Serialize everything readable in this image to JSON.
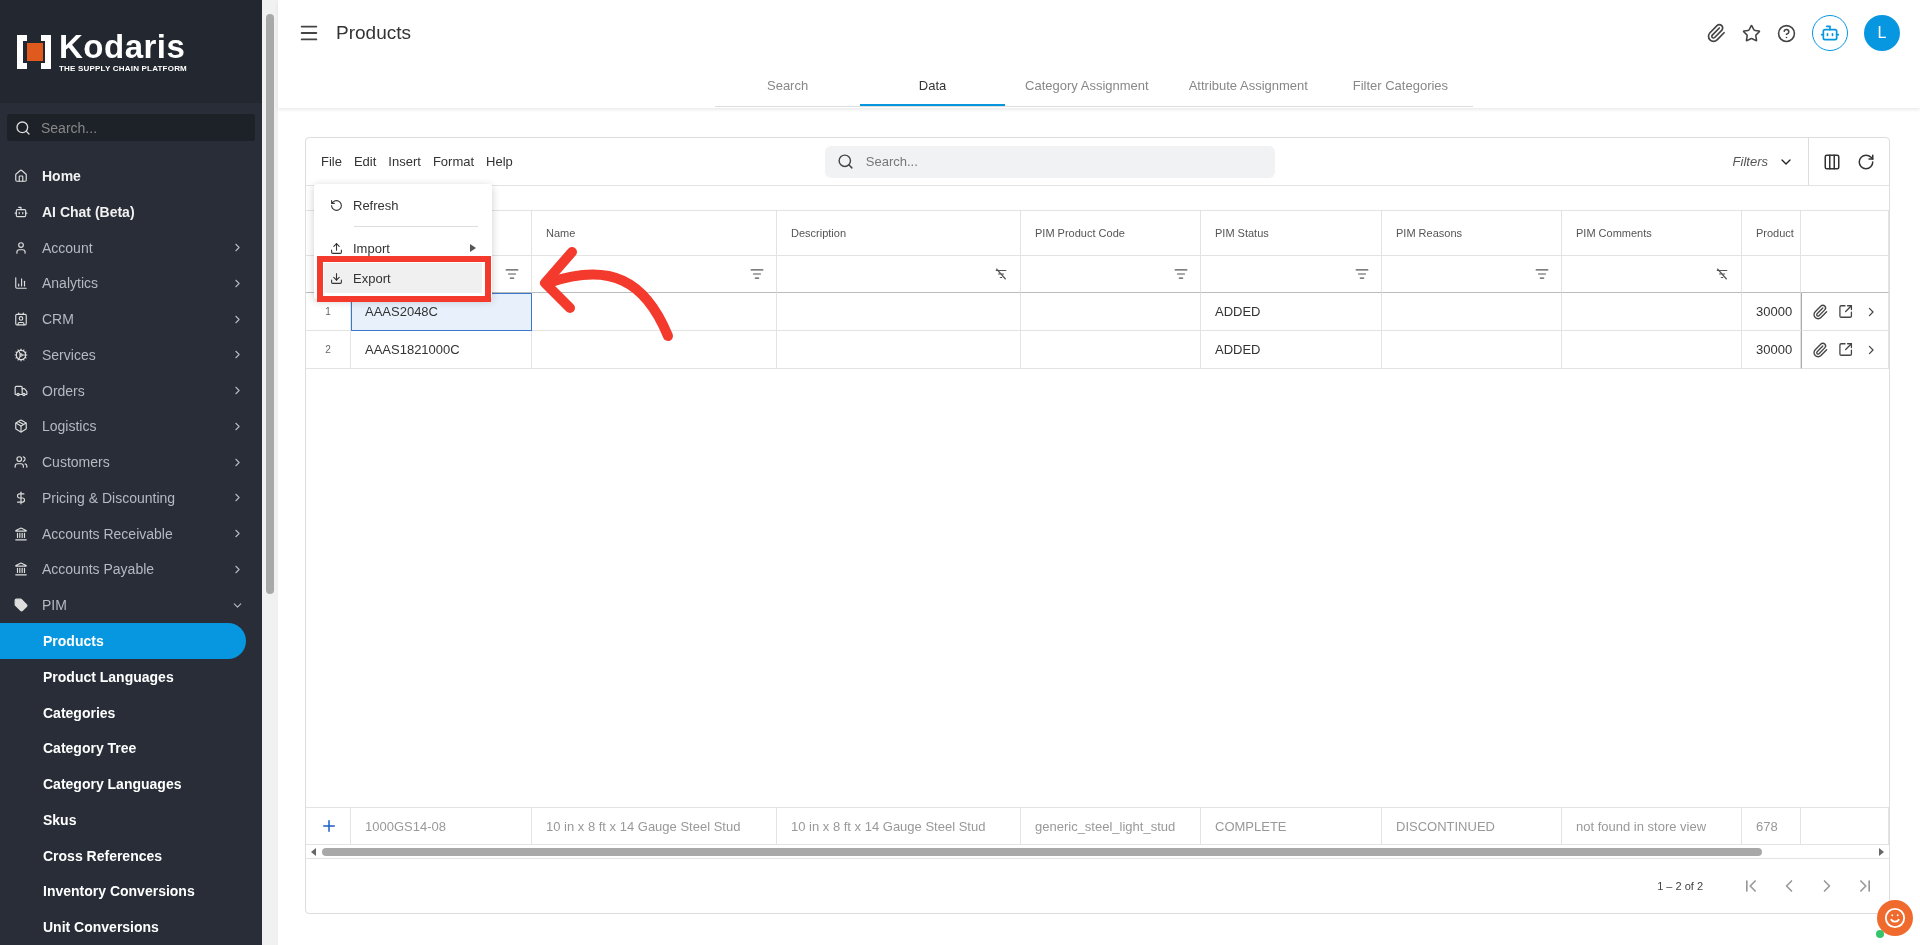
{
  "brand": {
    "name": "Kodaris",
    "tagline": "THE SUPPLY CHAIN PLATFORM"
  },
  "sidebar": {
    "search": {
      "placeholder": "Search..."
    },
    "items": [
      {
        "label": "Home",
        "kind": "link"
      },
      {
        "label": "AI Chat (Beta)",
        "kind": "link"
      },
      {
        "label": "Account",
        "kind": "group",
        "expanded": false
      },
      {
        "label": "Analytics",
        "kind": "group",
        "expanded": false
      },
      {
        "label": "CRM",
        "kind": "group",
        "expanded": false
      },
      {
        "label": "Services",
        "kind": "group",
        "expanded": false
      },
      {
        "label": "Orders",
        "kind": "group",
        "expanded": false
      },
      {
        "label": "Logistics",
        "kind": "group",
        "expanded": false
      },
      {
        "label": "Customers",
        "kind": "group",
        "expanded": false
      },
      {
        "label": "Pricing & Discounting",
        "kind": "group",
        "expanded": false
      },
      {
        "label": "Accounts Receivable",
        "kind": "group",
        "expanded": false
      },
      {
        "label": "Accounts Payable",
        "kind": "group",
        "expanded": false
      },
      {
        "label": "PIM",
        "kind": "group",
        "expanded": true,
        "children": [
          {
            "label": "Products",
            "selected": true
          },
          {
            "label": "Product Languages",
            "selected": false
          },
          {
            "label": "Categories",
            "selected": false
          },
          {
            "label": "Category Tree",
            "selected": false
          },
          {
            "label": "Category Languages",
            "selected": false
          },
          {
            "label": "Skus",
            "selected": false
          },
          {
            "label": "Cross References",
            "selected": false
          },
          {
            "label": "Inventory Conversions",
            "selected": false
          },
          {
            "label": "Unit Conversions",
            "selected": false
          }
        ]
      }
    ]
  },
  "header": {
    "title": "Products",
    "avatar": "L"
  },
  "tabs": [
    {
      "label": "Search",
      "selected": false
    },
    {
      "label": "Data",
      "selected": true
    },
    {
      "label": "Category Assignment",
      "selected": false
    },
    {
      "label": "Attribute Assignment",
      "selected": false
    },
    {
      "label": "Filter Categories",
      "selected": false
    }
  ],
  "toolbar": {
    "menus": [
      "File",
      "Edit",
      "Insert",
      "Format",
      "Help"
    ],
    "search": {
      "placeholder": "Search..."
    },
    "filters": "Filters"
  },
  "file_menu": [
    {
      "kind": "action",
      "label": "Refresh",
      "selected": false
    },
    {
      "kind": "divider"
    },
    {
      "kind": "submenu",
      "label": "Import",
      "selected": false
    },
    {
      "kind": "action",
      "label": "Export",
      "selected": true
    }
  ],
  "table": {
    "columns": [
      {
        "filter_enabled": true
      },
      {
        "label": "Name",
        "filter_enabled": true
      },
      {
        "label": "Description",
        "filter_enabled": false
      },
      {
        "label": "PIM Product Code",
        "filter_enabled": true
      },
      {
        "label": "PIM Status",
        "filter_enabled": true
      },
      {
        "label": "PIM Reasons",
        "filter_enabled": true
      },
      {
        "label": "PIM Comments",
        "filter_enabled": false
      },
      {
        "label": "Product"
      }
    ],
    "rows": [
      {
        "number": "1",
        "selected": true,
        "cells": [
          "AAAS2048C",
          "",
          "",
          "",
          "ADDED",
          "",
          "",
          "30000"
        ]
      },
      {
        "number": "2",
        "selected": false,
        "cells": [
          "AAAS1821000C",
          "",
          "",
          "",
          "ADDED",
          "",
          "",
          "30000"
        ]
      }
    ],
    "new_row": [
      "1000GS14-08",
      "10 in x 8 ft x 14 Gauge Steel Stud",
      "10 in x 8 ft x 14 Gauge Steel Stud",
      "generic_steel_light_stud",
      "COMPLETE",
      "DISCONTINUED",
      "not found in store view",
      "678"
    ]
  },
  "pagination": {
    "range": "1 – 2 of 2"
  }
}
